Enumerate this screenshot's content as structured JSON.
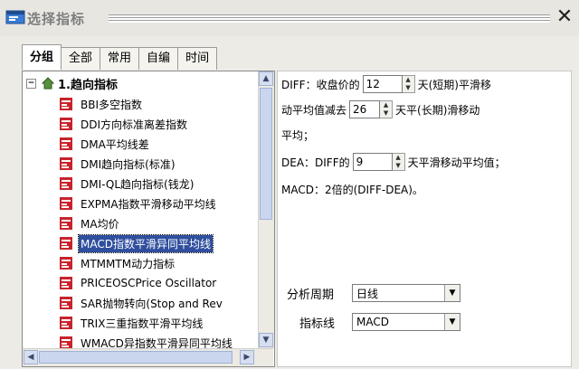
{
  "window": {
    "title": "选择指标",
    "close_glyph": "✕"
  },
  "tabs": [
    {
      "label": "分组",
      "active": true
    },
    {
      "label": "全部"
    },
    {
      "label": "常用"
    },
    {
      "label": "自编"
    },
    {
      "label": "时间"
    }
  ],
  "tree": {
    "expander": "−",
    "root_label": "1.趋向指标",
    "items": [
      "BBI多空指数",
      "DDI方向标准离差指数",
      "DMA平均线差",
      "DMI趋向指标(标准)",
      "DMI-QL趋向指标(钱龙)",
      "EXPMA指数平滑移动平均线",
      "MA均价",
      "MACD指数平滑异同平均线",
      "MTMMTM动力指标",
      "PRICEOSCPrice Oscillator",
      "SAR抛物转向(Stop and Rev",
      "TRIX三重指数平滑平均线",
      "WMACD异指数平滑异同平均线"
    ],
    "selected_index": 7
  },
  "params": {
    "diff_prefix": "DIFF：收盘价的",
    "diff_short_value": "12",
    "diff_short_suffix": "天(短期)平滑移",
    "line2_prefix": "动平均值减去",
    "diff_long_value": "26",
    "diff_long_suffix": "天平(长期)滑移动",
    "line3": "平均；",
    "dea_prefix": "DEA：DIFF的",
    "dea_value": "9",
    "dea_suffix": "天平滑移动平均值；",
    "macd_line": "MACD：2倍的(DIFF-DEA)。"
  },
  "options": {
    "period_label": "分析周期",
    "period_value": "日线",
    "indicator_label": "指标线",
    "indicator_value": "MACD"
  },
  "colors": {
    "accent": "#2f4f9e",
    "icon_red": "#c8232c"
  }
}
